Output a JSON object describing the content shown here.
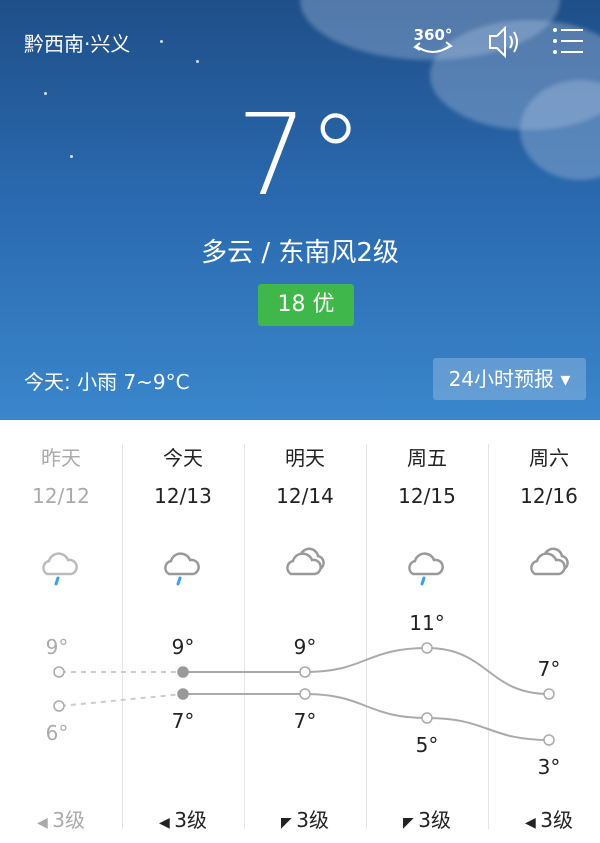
{
  "header": {
    "city": "黔西南·兴义",
    "icons": [
      "360-view-icon",
      "speaker-icon",
      "menu-icon"
    ],
    "view360_label": "360°"
  },
  "current": {
    "temperature": "7°",
    "condition": "多云 / 东南风2级",
    "aqi": "18 优",
    "aqi_color": "#3fb74a"
  },
  "today_summary": "今天:  小雨   7~9°C",
  "forecast_button": "24小时预报 ▾",
  "forecast": [
    {
      "name": "昨天",
      "date": "12/12",
      "icon": "light-rain-icon",
      "high": "9°",
      "low": "6°",
      "wind": "3级",
      "wind_arrow": "◀",
      "past": true
    },
    {
      "name": "今天",
      "date": "12/13",
      "icon": "light-rain-icon",
      "high": "9°",
      "low": "7°",
      "wind": "3级",
      "wind_arrow": "◀",
      "past": false
    },
    {
      "name": "明天",
      "date": "12/14",
      "icon": "cloudy-icon",
      "high": "9°",
      "low": "7°",
      "wind": "3级",
      "wind_arrow": "◤",
      "past": false
    },
    {
      "name": "周五",
      "date": "12/15",
      "icon": "light-rain-icon",
      "high": "11°",
      "low": "5°",
      "wind": "3级",
      "wind_arrow": "◤",
      "past": false
    },
    {
      "name": "周六",
      "date": "12/16",
      "icon": "cloudy-icon",
      "high": "7°",
      "low": "3°",
      "wind": "3级",
      "wind_arrow": "◀",
      "past": false
    }
  ],
  "chart_data": {
    "type": "line",
    "categories": [
      "12/12",
      "12/13",
      "12/14",
      "12/15",
      "12/16"
    ],
    "series": [
      {
        "values": [
          9,
          9,
          9,
          11,
          7
        ]
      },
      {
        "values": [
          6,
          7,
          7,
          5,
          3
        ]
      }
    ]
  }
}
